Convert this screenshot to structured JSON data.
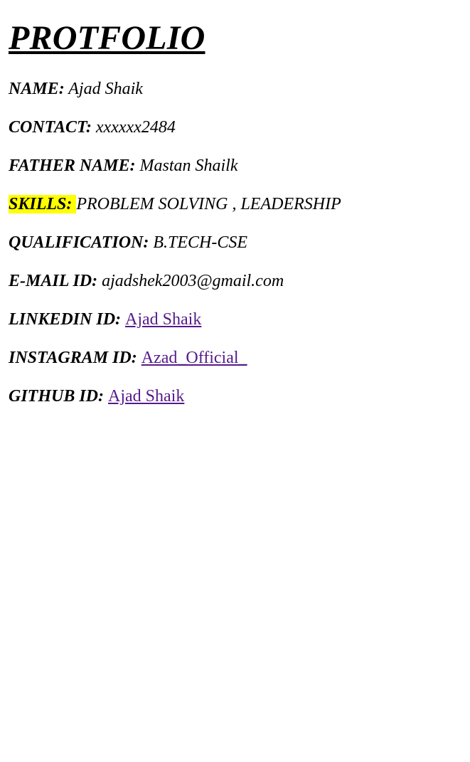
{
  "page": {
    "title": "PROTFOLIO"
  },
  "fields": {
    "name": {
      "label": "NAME:",
      "value": "Ajad Shaik"
    },
    "contact": {
      "label": "CONTACT:",
      "value": "xxxxxx2484"
    },
    "father_name": {
      "label": "FATHER NAME:",
      "value": "Mastan Shailk"
    },
    "skills": {
      "label": "SKILLS:",
      "value": "PROBLEM SOLVING , LEADERSHIP"
    },
    "qualification": {
      "label": "QUALIFICATION:",
      "value": "B.TECH-CSE"
    },
    "email": {
      "label": "E-MAIL ID:",
      "value": "ajadshek2003@gmail.com"
    },
    "linkedin": {
      "label": "LINKEDIN ID:",
      "link_text": "Ajad Shaik"
    },
    "instagram": {
      "label": "INSTAGRAM ID:",
      "link_text": "Azad_Official_"
    },
    "github": {
      "label": "GITHUB ID:",
      "link_text": "Ajad Shaik"
    }
  },
  "colors": {
    "highlight": "#ffff00",
    "visited_link": "#551a8b",
    "text": "#000000",
    "background": "#ffffff"
  }
}
